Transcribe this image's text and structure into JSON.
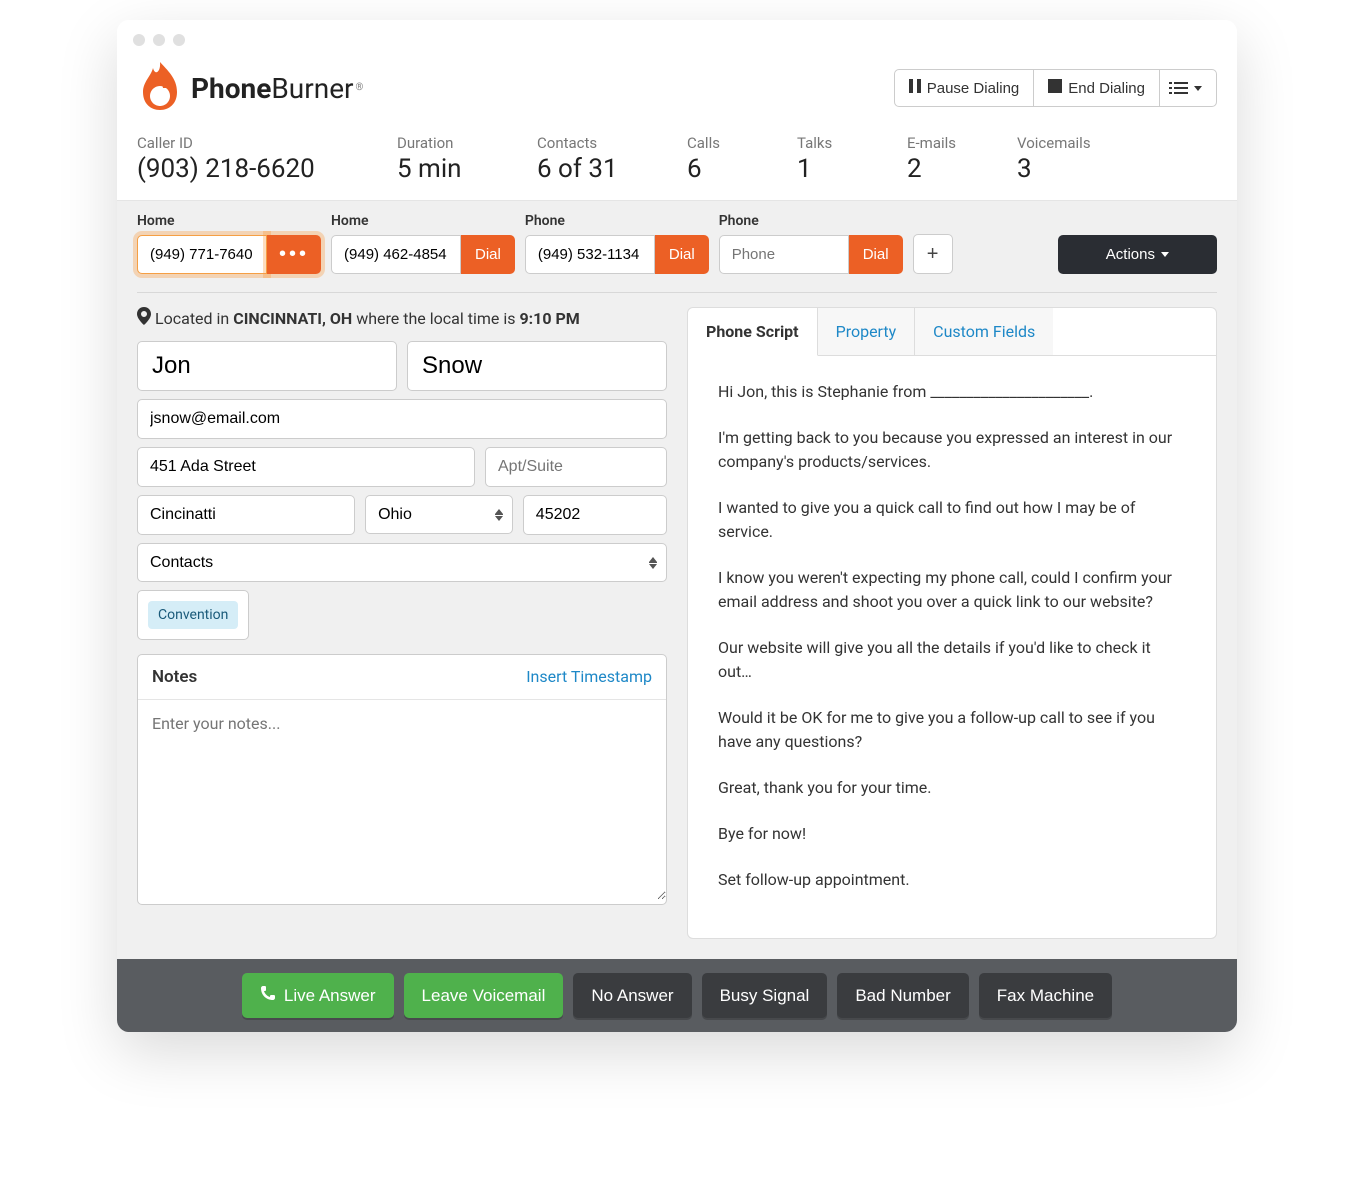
{
  "brand": {
    "name1": "Phone",
    "name2": "Burner"
  },
  "header_buttons": {
    "pause": "Pause Dialing",
    "end": "End Dialing"
  },
  "stats": {
    "caller_id_label": "Caller ID",
    "caller_id_value": "(903) 218-6620",
    "duration_label": "Duration",
    "duration_value": "5 min",
    "contacts_label": "Contacts",
    "contacts_value": "6 of 31",
    "calls_label": "Calls",
    "calls_value": "6",
    "talks_label": "Talks",
    "talks_value": "1",
    "emails_label": "E-mails",
    "emails_value": "2",
    "voicemails_label": "Voicemails",
    "voicemails_value": "3"
  },
  "phones": [
    {
      "label": "Home",
      "value": "(949) 771-7640",
      "btn": "•••",
      "active": true
    },
    {
      "label": "Home",
      "value": "(949) 462-4854",
      "btn": "Dial",
      "active": false
    },
    {
      "label": "Phone",
      "value": "(949) 532-1134",
      "btn": "Dial",
      "active": false
    },
    {
      "label": "Phone",
      "value": "",
      "placeholder": "Phone",
      "btn": "Dial",
      "active": false
    }
  ],
  "actions_label": "Actions",
  "location": {
    "prefix": "Located in ",
    "city": "CINCINNATI, OH",
    "middle": " where the local time is ",
    "time": "9:10 PM"
  },
  "contact": {
    "first_name": "Jon",
    "last_name": "Snow",
    "email": "jsnow@email.com",
    "address": "451 Ada Street",
    "apt_placeholder": "Apt/Suite",
    "city": "Cincinatti",
    "state": "Ohio",
    "zip": "45202",
    "list": "Contacts",
    "tag": "Convention"
  },
  "notes": {
    "title": "Notes",
    "insert": "Insert Timestamp",
    "placeholder": "Enter your notes..."
  },
  "tabs": {
    "script": "Phone Script",
    "property": "Property",
    "custom": "Custom Fields"
  },
  "script": {
    "p1": "Hi Jon, this is Stephanie from ______________________.",
    "p2": "I'm getting back to you because you expressed an interest in our company's products/services.",
    "p3": "I wanted to give you a quick call to find out how I may be of service.",
    "p4": "I know you weren't expecting my phone call, could I confirm your email address and shoot you over a quick link to our website?",
    "p5": "Our website will give you all the details if you'd like to check it out…",
    "p6": "Would it be OK for me to give you a follow-up call to see if you have any questions?",
    "p7": "Great, thank you for your time.",
    "p8": "Bye for now!",
    "p9": "Set follow-up appointment."
  },
  "dispositions": {
    "live": "Live Answer",
    "vm": "Leave Voicemail",
    "no": "No Answer",
    "busy": "Busy Signal",
    "bad": "Bad Number",
    "fax": "Fax Machine"
  }
}
